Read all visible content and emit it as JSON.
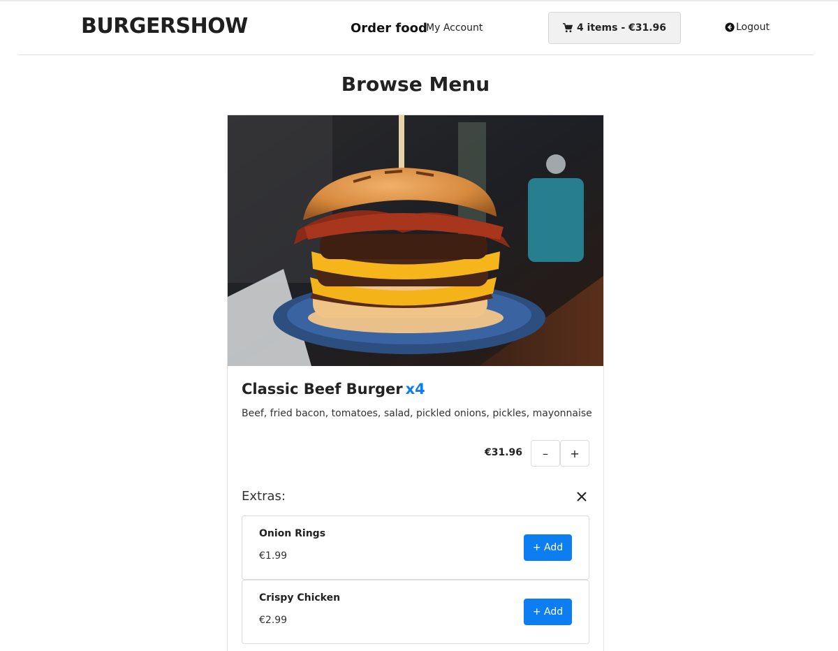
{
  "header": {
    "brand": "BURGERSHOW",
    "nav_order": "Order food",
    "nav_account": "My Account",
    "cart_label": "4 items - €31.96",
    "cart_icon": "cart-icon",
    "logout_label": "Logout",
    "logout_icon": "arrow-circle-left-icon"
  },
  "page": {
    "title": "Browse Menu"
  },
  "item": {
    "name": "Classic Beef Burger",
    "quantity_badge": "x4",
    "description": "Beef, fried bacon, tomatoes, salad, pickled onions, pickles, mayonnaise",
    "price": "€31.96",
    "minus_label": "–",
    "plus_label": "+",
    "accent_color": "#0d7ef2"
  },
  "extras": {
    "label": "Extras:",
    "close_icon": "close-icon",
    "items": [
      {
        "name": "Onion Rings",
        "price": "€1.99",
        "button": "+ Add"
      },
      {
        "name": "Crispy Chicken",
        "price": "€2.99",
        "button": "+ Add"
      }
    ]
  }
}
